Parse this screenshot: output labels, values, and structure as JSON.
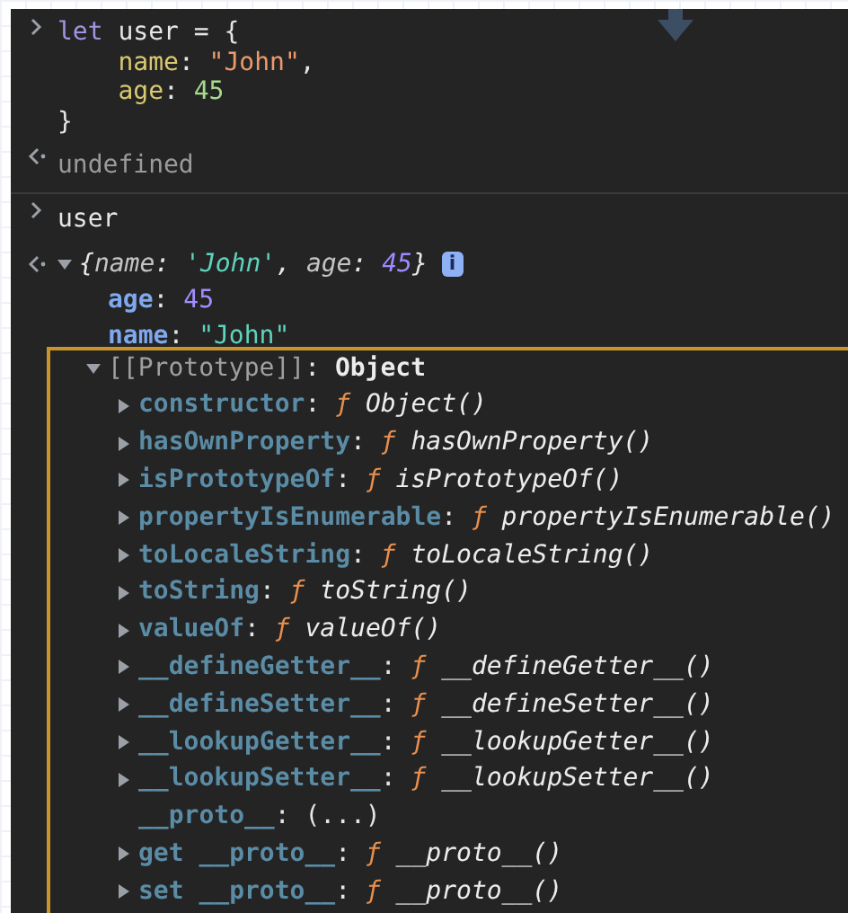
{
  "console": [
    {
      "kind": "input",
      "lines": [
        [
          {
            "kind": "keyword",
            "text": "let"
          },
          {
            "kind": "plain",
            "text": " user = {"
          }
        ],
        [
          {
            "kind": "prop",
            "text": "    name"
          },
          {
            "kind": "plain",
            "text": ": "
          },
          {
            "kind": "string",
            "text": "\"John\""
          },
          {
            "kind": "plain",
            "text": ","
          }
        ],
        [
          {
            "kind": "prop",
            "text": "    age"
          },
          {
            "kind": "plain",
            "text": ": "
          },
          {
            "kind": "number",
            "text": "45"
          }
        ],
        [
          {
            "kind": "plain",
            "text": "}"
          }
        ]
      ]
    },
    {
      "kind": "result",
      "lines": [
        [
          {
            "kind": "undefined",
            "text": "undefined"
          }
        ]
      ]
    },
    {
      "kind": "input",
      "lines": [
        [
          {
            "kind": "plain",
            "text": "user"
          }
        ]
      ]
    },
    {
      "kind": "object",
      "expanded": true,
      "badge": "i",
      "summary": [
        {
          "kind": "ipunct",
          "text": "{"
        },
        {
          "kind": "ikey",
          "text": "name"
        },
        {
          "kind": "ipunct",
          "text": ": "
        },
        {
          "kind": "istring",
          "text": "'John'"
        },
        {
          "kind": "ipunct",
          "text": ", "
        },
        {
          "kind": "ikey",
          "text": "age"
        },
        {
          "kind": "ipunct",
          "text": ": "
        },
        {
          "kind": "inumber",
          "text": "45"
        },
        {
          "kind": "ipunct",
          "text": "}"
        }
      ],
      "properties": [
        [
          {
            "kind": "ownkey",
            "text": "age"
          },
          {
            "kind": "plain",
            "text": ": "
          },
          {
            "kind": "ownnum",
            "text": "45"
          }
        ],
        [
          {
            "kind": "ownkey",
            "text": "name"
          },
          {
            "kind": "plain",
            "text": ": "
          },
          {
            "kind": "ownstr",
            "text": "\"John\""
          }
        ]
      ],
      "prototype": {
        "expanded": true,
        "highlighted": true,
        "tokens": [
          {
            "kind": "label",
            "text": "[[Prototype]]"
          },
          {
            "kind": "plain",
            "text": ": "
          },
          {
            "kind": "type",
            "text": "Object"
          }
        ],
        "members": [
          {
            "kind": "function",
            "expanded": false,
            "tokens": [
              {
                "kind": "protokey",
                "text": "constructor"
              },
              {
                "kind": "plain",
                "text": ": "
              },
              {
                "kind": "fn",
                "text": "ƒ"
              },
              {
                "kind": "fnvalue",
                "text": " Object()"
              }
            ]
          },
          {
            "kind": "function",
            "expanded": false,
            "tokens": [
              {
                "kind": "protokey",
                "text": "hasOwnProperty"
              },
              {
                "kind": "plain",
                "text": ": "
              },
              {
                "kind": "fn",
                "text": "ƒ"
              },
              {
                "kind": "fnvalue",
                "text": " hasOwnProperty()"
              }
            ]
          },
          {
            "kind": "function",
            "expanded": false,
            "tokens": [
              {
                "kind": "protokey",
                "text": "isPrototypeOf"
              },
              {
                "kind": "plain",
                "text": ": "
              },
              {
                "kind": "fn",
                "text": "ƒ"
              },
              {
                "kind": "fnvalue",
                "text": " isPrototypeOf()"
              }
            ]
          },
          {
            "kind": "function",
            "expanded": false,
            "tokens": [
              {
                "kind": "protokey",
                "text": "propertyIsEnumerable"
              },
              {
                "kind": "plain",
                "text": ": "
              },
              {
                "kind": "fn",
                "text": "ƒ"
              },
              {
                "kind": "fnvalue",
                "text": " propertyIsEnumerable()"
              }
            ]
          },
          {
            "kind": "function",
            "expanded": false,
            "tokens": [
              {
                "kind": "protokey",
                "text": "toLocaleString"
              },
              {
                "kind": "plain",
                "text": ": "
              },
              {
                "kind": "fn",
                "text": "ƒ"
              },
              {
                "kind": "fnvalue",
                "text": " toLocaleString()"
              }
            ]
          },
          {
            "kind": "function",
            "expanded": false,
            "tokens": [
              {
                "kind": "protokey",
                "text": "toString"
              },
              {
                "kind": "plain",
                "text": ": "
              },
              {
                "kind": "fn",
                "text": "ƒ"
              },
              {
                "kind": "fnvalue",
                "text": " toString()"
              }
            ]
          },
          {
            "kind": "function",
            "expanded": false,
            "tokens": [
              {
                "kind": "protokey",
                "text": "valueOf"
              },
              {
                "kind": "plain",
                "text": ": "
              },
              {
                "kind": "fn",
                "text": "ƒ"
              },
              {
                "kind": "fnvalue",
                "text": " valueOf()"
              }
            ]
          },
          {
            "kind": "function",
            "expanded": false,
            "tokens": [
              {
                "kind": "protokey",
                "text": "__defineGetter__"
              },
              {
                "kind": "plain",
                "text": ": "
              },
              {
                "kind": "fn",
                "text": "ƒ"
              },
              {
                "kind": "fnvalue",
                "text": " __defineGetter__()"
              }
            ]
          },
          {
            "kind": "function",
            "expanded": false,
            "tokens": [
              {
                "kind": "protokey",
                "text": "__defineSetter__"
              },
              {
                "kind": "plain",
                "text": ": "
              },
              {
                "kind": "fn",
                "text": "ƒ"
              },
              {
                "kind": "fnvalue",
                "text": " __defineSetter__()"
              }
            ]
          },
          {
            "kind": "function",
            "expanded": false,
            "tokens": [
              {
                "kind": "protokey",
                "text": "__lookupGetter__"
              },
              {
                "kind": "plain",
                "text": ": "
              },
              {
                "kind": "fn",
                "text": "ƒ"
              },
              {
                "kind": "fnvalue",
                "text": " __lookupGetter__()"
              }
            ]
          },
          {
            "kind": "function",
            "expanded": false,
            "tokens": [
              {
                "kind": "protokey",
                "text": "__lookupSetter__"
              },
              {
                "kind": "plain",
                "text": ": "
              },
              {
                "kind": "fn",
                "text": "ƒ"
              },
              {
                "kind": "fnvalue",
                "text": " __lookupSetter__()"
              }
            ]
          },
          {
            "kind": "lazy",
            "tokens": [
              {
                "kind": "protokey",
                "text": "__proto__"
              },
              {
                "kind": "plain",
                "text": ": (...)"
              }
            ]
          },
          {
            "kind": "function",
            "expanded": false,
            "tokens": [
              {
                "kind": "protokey",
                "text": "get __proto__"
              },
              {
                "kind": "plain",
                "text": ": "
              },
              {
                "kind": "fn",
                "text": "ƒ"
              },
              {
                "kind": "fnvalue",
                "text": " __proto__()"
              }
            ]
          },
          {
            "kind": "function",
            "expanded": false,
            "tokens": [
              {
                "kind": "protokey",
                "text": "set __proto__"
              },
              {
                "kind": "plain",
                "text": ": "
              },
              {
                "kind": "fn",
                "text": "ƒ"
              },
              {
                "kind": "fnvalue",
                "text": " __proto__()"
              }
            ]
          }
        ]
      }
    }
  ]
}
